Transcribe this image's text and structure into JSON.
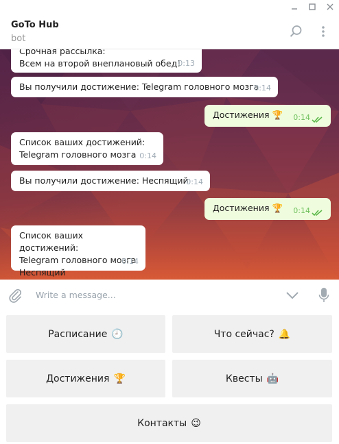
{
  "window": {
    "controls": [
      "—",
      "□",
      "✕"
    ]
  },
  "header": {
    "title": "GoTo Hub",
    "subtitle": "bot",
    "search_icon": "search-icon",
    "menu_icon": "more-vertical-icon"
  },
  "messages": [
    {
      "dir": "in",
      "lines": [
        "Срочная рассылка:",
        "Всем на второй внеплановый обед!"
      ],
      "time": "0:13"
    },
    {
      "dir": "in",
      "lines": [
        "Вы получили достижение: Telegram головного мозга"
      ],
      "time": "0:14"
    },
    {
      "dir": "out",
      "text": "Достижения",
      "emoji": "🏆",
      "time": "0:14"
    },
    {
      "dir": "in",
      "lines": [
        "Список ваших достижений:",
        "Telegram головного мозга"
      ],
      "time": "0:14"
    },
    {
      "dir": "in",
      "lines": [
        "Вы получили достижение: Неспящий"
      ],
      "time": "0:14"
    },
    {
      "dir": "out",
      "text": "Достижения",
      "emoji": "🏆",
      "time": "0:14"
    },
    {
      "dir": "in",
      "lines": [
        "Список ваших достижений:",
        "Telegram головного мозга",
        "Неспящий"
      ],
      "time": "0:14"
    }
  ],
  "input": {
    "placeholder": "Write a message...",
    "attach_icon": "paperclip-icon",
    "down_icon": "chevron-down-icon",
    "mic_icon": "microphone-icon"
  },
  "keyboard": {
    "buttons": [
      {
        "label": "Расписание",
        "emoji": "🕘"
      },
      {
        "label": "Что сейчас?",
        "emoji": "🔔"
      },
      {
        "label": "Достижения",
        "emoji": "🏆"
      },
      {
        "label": "Квесты",
        "emoji": "🤖"
      },
      {
        "label": "Контакты",
        "emoji": "😉"
      }
    ]
  },
  "colors": {
    "outgoing_bubble": "#effdde",
    "incoming_bubble": "#ffffff",
    "read_ticks": "#5cb84a",
    "keyboard_button": "#f0f0f0"
  }
}
